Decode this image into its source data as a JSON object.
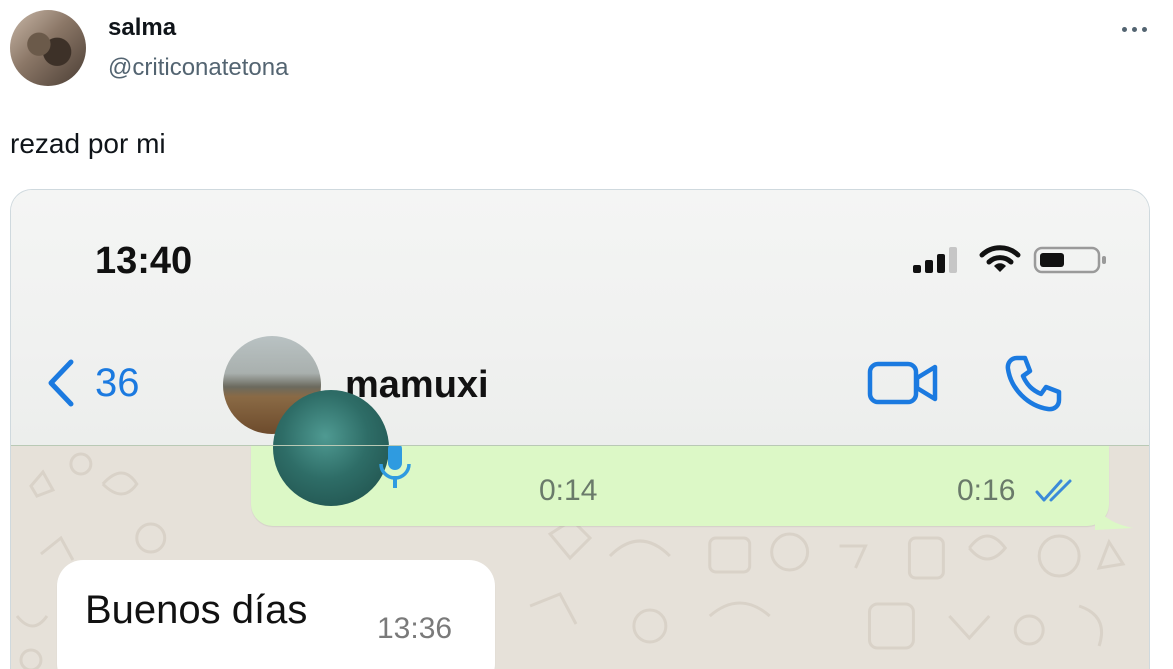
{
  "tweet": {
    "display_name": "salma",
    "handle": "@criticonatetona",
    "text": "rezad por mi"
  },
  "screenshot": {
    "status_bar": {
      "time": "13:40"
    },
    "chat_header": {
      "back_count": "36",
      "contact_name": "mamuxi",
      "accent_color": "#1b7ae0"
    },
    "messages": [
      {
        "direction": "outgoing",
        "type": "voice",
        "duration": "0:14",
        "time": "0:16",
        "status": "read"
      },
      {
        "direction": "incoming",
        "type": "text",
        "text": "Buenos días",
        "time": "13:36"
      }
    ],
    "colors": {
      "outgoing_bubble": "#dcf8c6",
      "incoming_bubble": "#ffffff",
      "chat_wallpaper": "#e6e1d9"
    }
  }
}
